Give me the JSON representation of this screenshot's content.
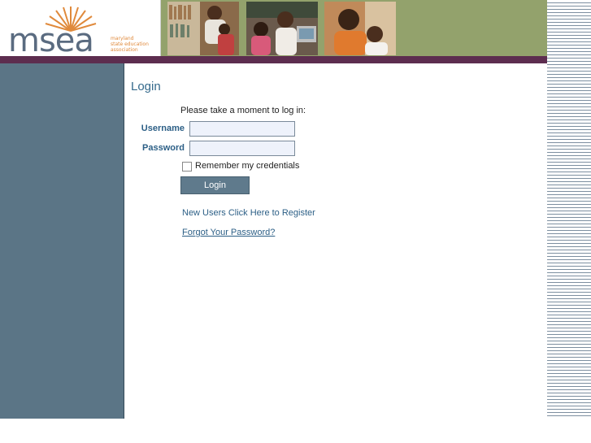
{
  "header": {
    "logo_word": "msea",
    "logo_tagline": [
      "maryland",
      "state education",
      "association"
    ]
  },
  "login": {
    "title": "Login",
    "prompt": "Please take a moment to log in:",
    "username_label": "Username",
    "password_label": "Password",
    "username_value": "",
    "password_value": "",
    "remember_label": "Remember my credentials",
    "remember_checked": false,
    "login_button": "Login",
    "register_link": "New Users Click Here to Register",
    "forgot_link": "Forgot Your Password?"
  },
  "colors": {
    "header_green": "#93a26c",
    "purple_bar": "#5d2d4f",
    "sidebar": "#5b7586",
    "link_blue": "#2c5f86",
    "logo_orange": "#e08a3c"
  }
}
